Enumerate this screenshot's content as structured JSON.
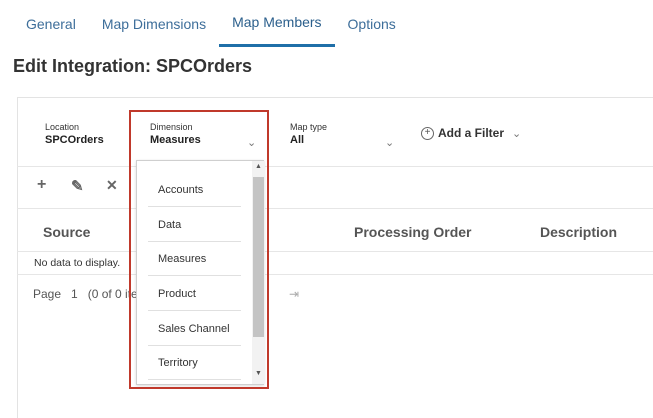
{
  "tabs": [
    {
      "label": "General"
    },
    {
      "label": "Map Dimensions"
    },
    {
      "label": "Map Members"
    },
    {
      "label": "Options"
    }
  ],
  "page_title": "Edit Integration: SPCOrders",
  "filters": {
    "location": {
      "label": "Location",
      "value": "SPCOrders"
    },
    "dimension": {
      "label": "Dimension",
      "value": "Measures"
    },
    "map_type": {
      "label": "Map type",
      "value": "All"
    },
    "add_filter": "Add a Filter"
  },
  "toolbar": {
    "add_icon": "+",
    "edit_icon": "✎",
    "delete_icon": "✕"
  },
  "table": {
    "columns": [
      "Source",
      "Processing Order",
      "Description"
    ],
    "empty_message": "No data to display."
  },
  "pager": {
    "text": "Page   1   (0 of 0 ite",
    "last": "⇥"
  },
  "dimension_dropdown": {
    "options": [
      "Accounts",
      "Data",
      "Measures",
      "Product",
      "Sales Channel",
      "Territory"
    ]
  },
  "colors": {
    "tab_active_underline": "#1f6fa8",
    "highlight_border": "#c0392b"
  }
}
